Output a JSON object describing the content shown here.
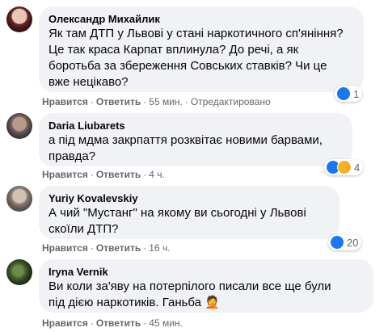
{
  "comments": [
    {
      "author": "Олександр Михайлик",
      "text": "Як там ДТП у Львові у стані наркотичного сп'яніння?\nЦе так краса Карпат вплинула? До речі, а як\nборотьба за збереження Совських ставків? Чи це\nвже нецікаво?",
      "like": "Нравится",
      "reply": "Ответить",
      "time": "55 мин.",
      "edited": "Отредактировано",
      "reactions_count": "1"
    },
    {
      "author": "Daria Liubarets",
      "text": "а під мдма закрпаття розквітає новими барвами,\nправда?",
      "like": "Нравится",
      "reply": "Ответить",
      "time": "4 ч.",
      "reactions_count": "4"
    },
    {
      "author": "Yuriy Kovalevskiy",
      "text": "А чий \"Мустанг\" на якому ви сьогодні у Львові\nскоїли ДТП?",
      "like": "Нравится",
      "reply": "Ответить",
      "time": "16 ч.",
      "reactions_count": "20"
    },
    {
      "author": "Iryna Vernik",
      "text": "Ви коли за'яву на потерпілого писали все ще були\nпід дією наркотиків. Ганьба 🤦",
      "like": "Нравится",
      "reply": "Ответить",
      "time": "45 мин."
    }
  ],
  "colors": {
    "bubble": "#f0f2f5",
    "meta_text": "#65676b",
    "like_blue": "#1877f2",
    "haha_yellow": "#f7b125"
  },
  "icons": {
    "like": "like-icon",
    "haha": "haha-icon"
  }
}
